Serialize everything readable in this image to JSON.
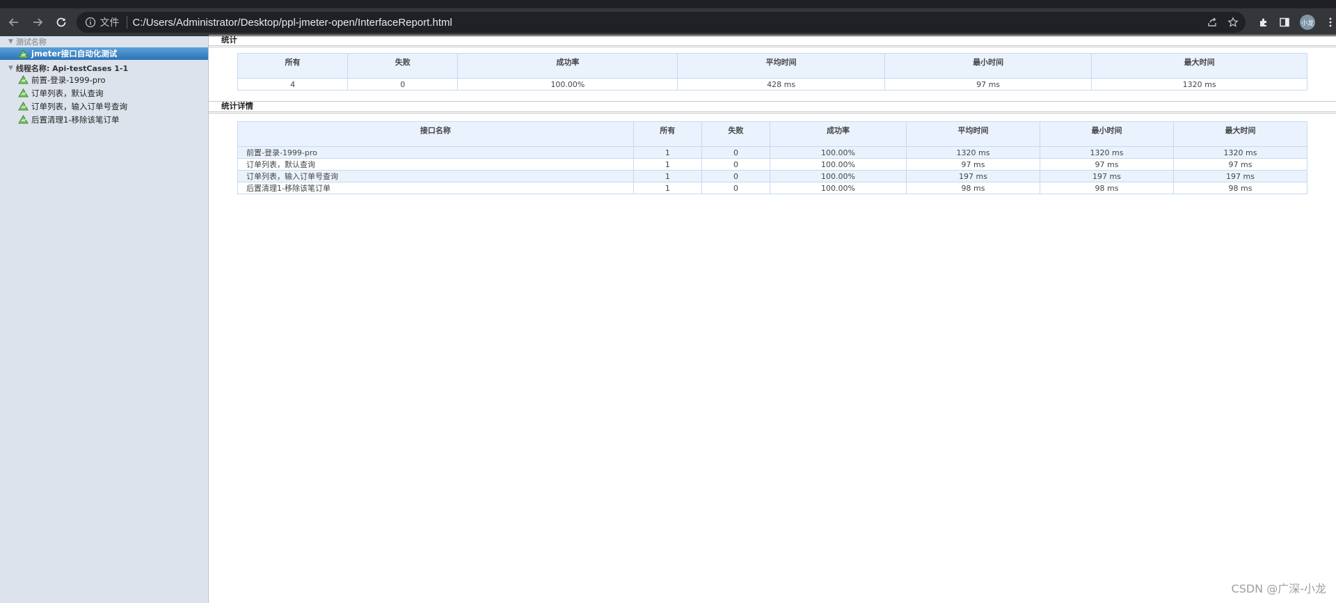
{
  "browser": {
    "scheme_label": "文件",
    "url": "C:/Users/Administrator/Desktop/ppl-jmeter-open/InterfaceReport.html",
    "avatar_text": "小龙"
  },
  "sidebar": {
    "header_test": "测试名称",
    "selected_item": "jmeter接口自动化测试",
    "header_thread": "线程名称: Api-testCases 1-1",
    "items": [
      {
        "label": "前置-登录-1999-pro"
      },
      {
        "label": "订单列表，默认查询"
      },
      {
        "label": "订单列表，输入订单号查询"
      },
      {
        "label": "后置清理1-移除该笔订单"
      }
    ]
  },
  "summary": {
    "title": "统计",
    "headers": [
      "所有",
      "失败",
      "成功率",
      "平均时间",
      "最小时间",
      "最大时间"
    ],
    "row": [
      "4",
      "0",
      "100.00%",
      "428 ms",
      "97 ms",
      "1320 ms"
    ]
  },
  "details": {
    "title": "统计详情",
    "headers": [
      "接口名称",
      "所有",
      "失败",
      "成功率",
      "平均时间",
      "最小时间",
      "最大时间"
    ],
    "rows": [
      [
        "前置-登录-1999-pro",
        "1",
        "0",
        "100.00%",
        "1320 ms",
        "1320 ms",
        "1320 ms"
      ],
      [
        "订单列表，默认查询",
        "1",
        "0",
        "100.00%",
        "97 ms",
        "97 ms",
        "97 ms"
      ],
      [
        "订单列表，输入订单号查询",
        "1",
        "0",
        "100.00%",
        "197 ms",
        "197 ms",
        "197 ms"
      ],
      [
        "后置清理1-移除该笔订单",
        "1",
        "0",
        "100.00%",
        "98 ms",
        "98 ms",
        "98 ms"
      ]
    ]
  },
  "watermark": "CSDN @广深-小龙",
  "colors": {
    "selection": "#2d73b6",
    "header_bg": "#eaf2fd",
    "sidebar_bg": "#dde3ec"
  }
}
